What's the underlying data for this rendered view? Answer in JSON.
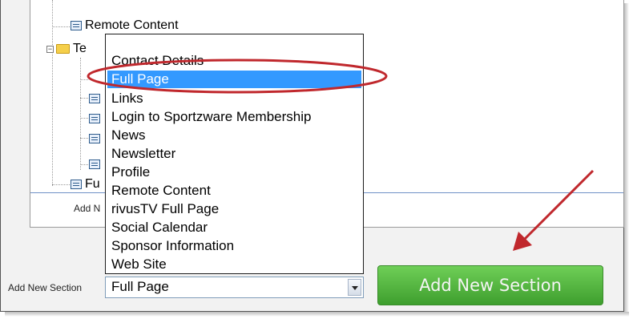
{
  "tree": {
    "rows": [
      {
        "label": "Remote Content"
      },
      {
        "label": "Te"
      },
      {
        "label": "Fu"
      }
    ],
    "add_new_truncated": "Add N"
  },
  "dropdown": {
    "options": [
      "Contact Details",
      "Full Page",
      "Links",
      "Login to Sportzware Membership",
      "News",
      "Newsletter",
      "Profile",
      "Remote Content",
      "rivusTV Full Page",
      "Social Calendar",
      "Sponsor Information",
      "Web Site"
    ],
    "selected_index": 1
  },
  "form": {
    "section_label": "Add New Section",
    "selected_value": "Full Page",
    "button_label": "Add New Section"
  },
  "colors": {
    "highlight": "#3399ff",
    "annotation": "#c0282d",
    "button_green": "#4caf3a"
  },
  "icons": [
    "document-icon",
    "folder-icon",
    "expander-minus-icon",
    "dropdown-arrow-icon"
  ]
}
